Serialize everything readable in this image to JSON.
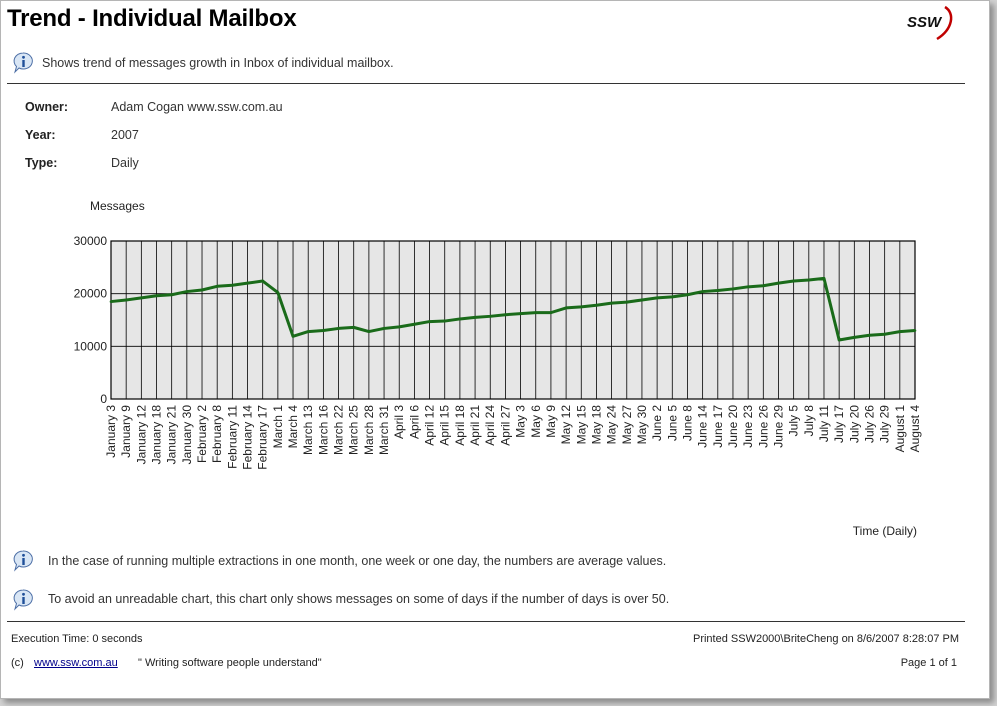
{
  "header": {
    "title": "Trend - Individual Mailbox",
    "description": "Shows trend of messages growth in Inbox of individual mailbox.",
    "logo_text": "SSW"
  },
  "params": {
    "owner_label": "Owner:",
    "owner_value": "Adam Cogan www.ssw.com.au",
    "year_label": "Year:",
    "year_value": "2007",
    "type_label": "Type:",
    "type_value": "Daily"
  },
  "chart_data": {
    "type": "line",
    "ylabel": "Messages",
    "xlabel": "Time (Daily)",
    "ylim": [
      0,
      30000
    ],
    "yticks": [
      "0",
      "10000",
      "20000",
      "30000"
    ],
    "grid": true,
    "line_color": "#1a6b1a",
    "plot_bg": "#e6e6e6",
    "categories": [
      "January 3",
      "January 9",
      "January 12",
      "January 18",
      "January 21",
      "January 30",
      "February 2",
      "February 8",
      "February 11",
      "February 14",
      "February 17",
      "March 1",
      "March 4",
      "March 13",
      "March 16",
      "March 22",
      "March 25",
      "March 28",
      "March 31",
      "April 3",
      "April 6",
      "April 12",
      "April 15",
      "April 18",
      "April 21",
      "April 24",
      "April 27",
      "May 3",
      "May 6",
      "May 9",
      "May 12",
      "May 15",
      "May 18",
      "May 24",
      "May 27",
      "May 30",
      "June 2",
      "June 5",
      "June 8",
      "June 14",
      "June 17",
      "June 20",
      "June 23",
      "June 26",
      "June 29",
      "July 5",
      "July 8",
      "July 11",
      "July 17",
      "July 20",
      "July 26",
      "July 29",
      "August 1",
      "August 4"
    ],
    "values": [
      18500,
      18800,
      19200,
      19600,
      19800,
      20400,
      20700,
      21400,
      21600,
      22000,
      22400,
      20200,
      11900,
      12800,
      13000,
      13400,
      13600,
      12800,
      13400,
      13700,
      14200,
      14700,
      14800,
      15200,
      15500,
      15700,
      16000,
      16200,
      16400,
      16400,
      17300,
      17500,
      17800,
      18200,
      18400,
      18800,
      19200,
      19400,
      19800,
      20400,
      20600,
      20900,
      21300,
      21500,
      22000,
      22400,
      22600,
      22900,
      11200,
      11700,
      12100,
      12300,
      12800,
      13000
    ]
  },
  "notes": [
    "In the case of running multiple extractions in one month, one week or one day, the numbers are average values.",
    "To avoid an unreadable chart, this chart only shows messages on some of days if the number of days is over 50."
  ],
  "footer": {
    "execution_time": "Execution Time: 0 seconds",
    "printed": "Printed SSW2000\\BriteCheng on 8/6/2007 8:28:07 PM",
    "copyright": "(c)",
    "link": "www.ssw.com.au",
    "tagline": "\" Writing software people understand\"",
    "page": "Page 1 of 1"
  }
}
